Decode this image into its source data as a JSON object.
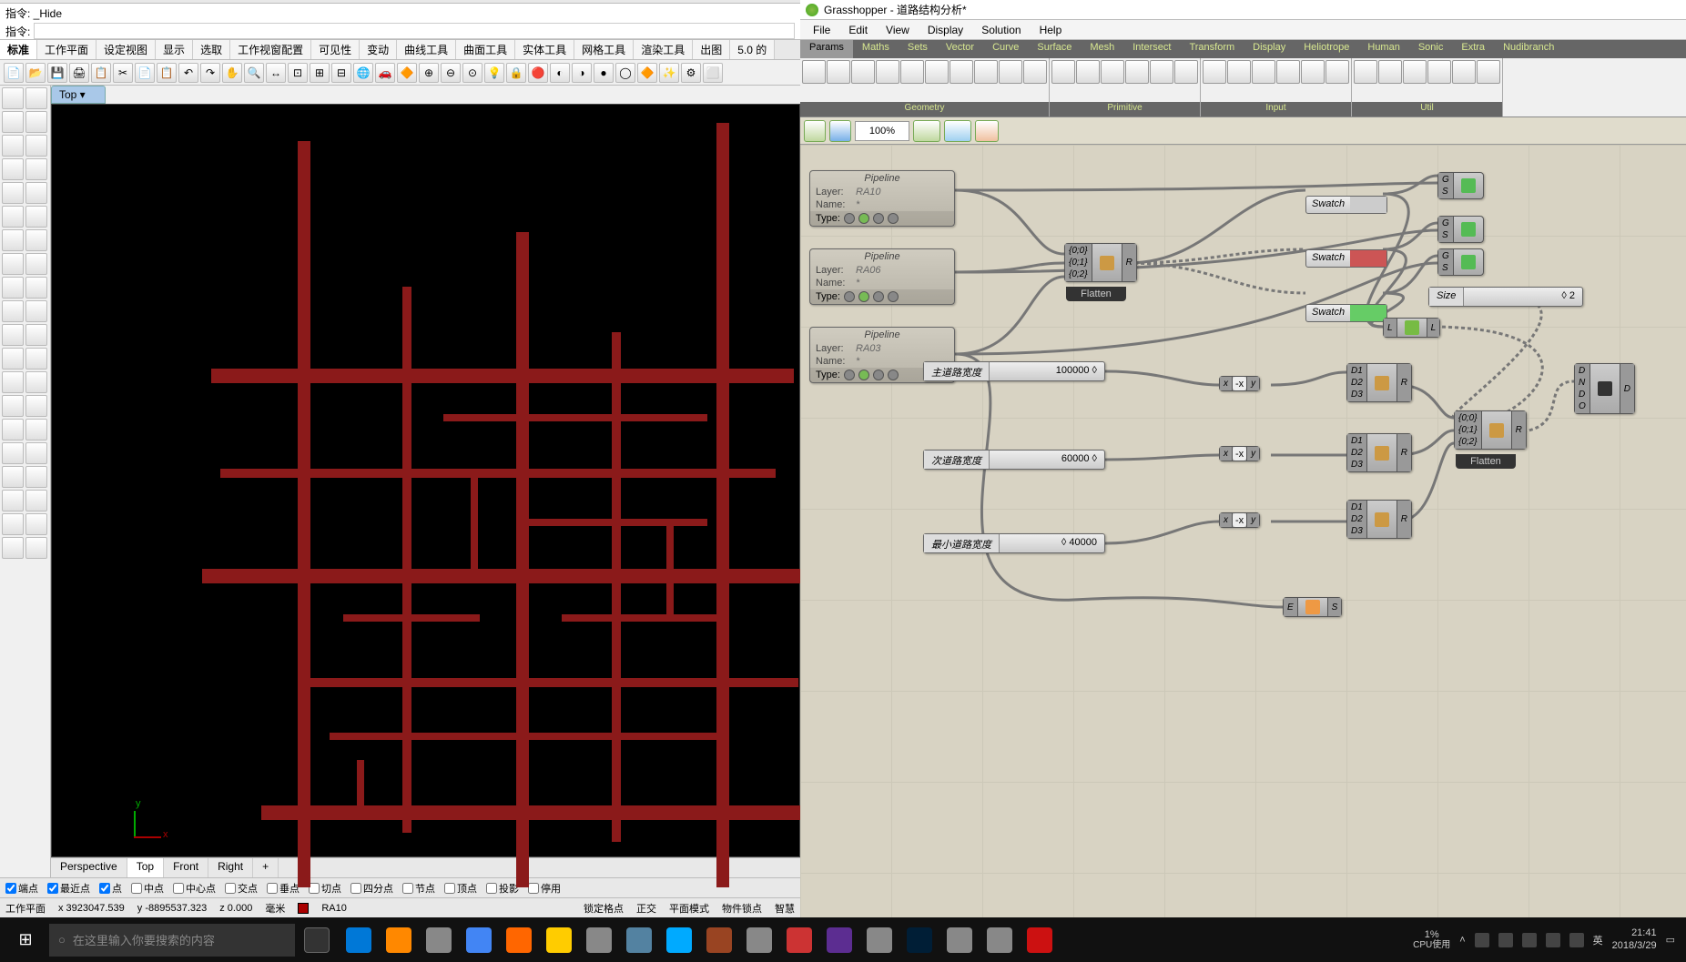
{
  "rhino": {
    "cmd_prev": "指令: _Hide",
    "cmd_label": "指令:",
    "tabs": [
      "标准",
      "工作平面",
      "设定视图",
      "显示",
      "选取",
      "工作视窗配置",
      "可见性",
      "变动",
      "曲线工具",
      "曲面工具",
      "实体工具",
      "网格工具",
      "渲染工具",
      "出图",
      "5.0 的"
    ],
    "active_tab": "标准",
    "vp_label": "Top ▾",
    "bottom_tabs": [
      "Perspective",
      "Top",
      "Front",
      "Right",
      "+"
    ],
    "active_btab": "Top",
    "osnap": {
      "端点": "端点",
      "最近点": "最近点",
      "点": "点",
      "中点": "中点",
      "中心点": "中心点",
      "交点": "交点",
      "垂点": "垂点",
      "切点": "切点",
      "四分点": "四分点",
      "节点": "节点",
      "顶点": "顶点",
      "投影": "投影",
      "停用": "停用"
    },
    "status": {
      "wplane": "工作平面",
      "x": "x 3923047.539",
      "y": "y -8895537.323",
      "z": "z 0.000",
      "unit": "毫米",
      "layer": "RA10",
      "grid": "锁定格点",
      "ortho": "正交",
      "planar": "平面模式",
      "osnap": "物件锁点",
      "smart": "智慧"
    }
  },
  "gh": {
    "title": "Grasshopper - 道路结构分析*",
    "menu": [
      "File",
      "Edit",
      "View",
      "Display",
      "Solution",
      "Help"
    ],
    "rtabs": [
      "Params",
      "Maths",
      "Sets",
      "Vector",
      "Curve",
      "Surface",
      "Mesh",
      "Intersect",
      "Transform",
      "Display",
      "Heliotrope",
      "Human",
      "Sonic",
      "Extra",
      "Nudibranch"
    ],
    "active_rtab": "Params",
    "groups": [
      "Geometry",
      "Primitive",
      "Input",
      "Util"
    ],
    "zoom": "100%",
    "pipelines": [
      {
        "title": "Pipeline",
        "layer": "RA10",
        "name": "*"
      },
      {
        "title": "Pipeline",
        "layer": "RA06",
        "name": "*"
      },
      {
        "title": "Pipeline",
        "layer": "RA03",
        "name": "*"
      }
    ],
    "pipeline_labels": {
      "layer": "Layer:",
      "name": "Name:",
      "type": "Type:"
    },
    "entwine_a": {
      "i": [
        "{0;0}",
        "{0;1}",
        "{0;2}"
      ],
      "o": "R",
      "label": "Flatten"
    },
    "entwine_b": {
      "i": [
        "{0;0}",
        "{0;1}",
        "{0;2}"
      ],
      "o": "R",
      "label": "Flatten"
    },
    "swatches": [
      {
        "label": "Swatch",
        "color": "#ccc"
      },
      {
        "label": "Swatch",
        "color": "#c55"
      },
      {
        "label": "Swatch",
        "color": "#6c6"
      }
    ],
    "preview": {
      "i": [
        "G",
        "S"
      ]
    },
    "size": {
      "label": "Size",
      "val": "◊ 2"
    },
    "sliders": [
      {
        "label": "主道路宽度",
        "val": "100000 ◊"
      },
      {
        "label": "次道路宽度",
        "val": "60000 ◊"
      },
      {
        "label": "最小道路宽度",
        "val": "◊ 40000"
      }
    ],
    "neg": {
      "in": [
        "x",
        "y"
      ],
      "mid": "-x",
      "out": ""
    },
    "d3": {
      "in": [
        "D1",
        "D2",
        "D3"
      ],
      "out": "R"
    },
    "bake": {
      "in": [
        "D",
        "N",
        "D",
        "O"
      ],
      "out": ""
    },
    "ll": {
      "in": "L",
      "out": "L"
    },
    "es": {
      "in": "E",
      "out": "S"
    }
  },
  "taskbar": {
    "search_placeholder": "在这里输入你要搜索的内容",
    "cpu": "1%",
    "cpu_label": "CPU使用",
    "ime": "英",
    "time": "21:41",
    "date": "2018/3/29",
    "apps": [
      "#0078d7",
      "#ff8800",
      "#888",
      "#4285f4",
      "#ff6600",
      "#ffcc00",
      "#888",
      "#5382a1",
      "#00aaff",
      "#942",
      "#888",
      "#c33",
      "#5c2d91",
      "#888",
      "#001e36",
      "#888",
      "#888",
      "#c11"
    ]
  }
}
